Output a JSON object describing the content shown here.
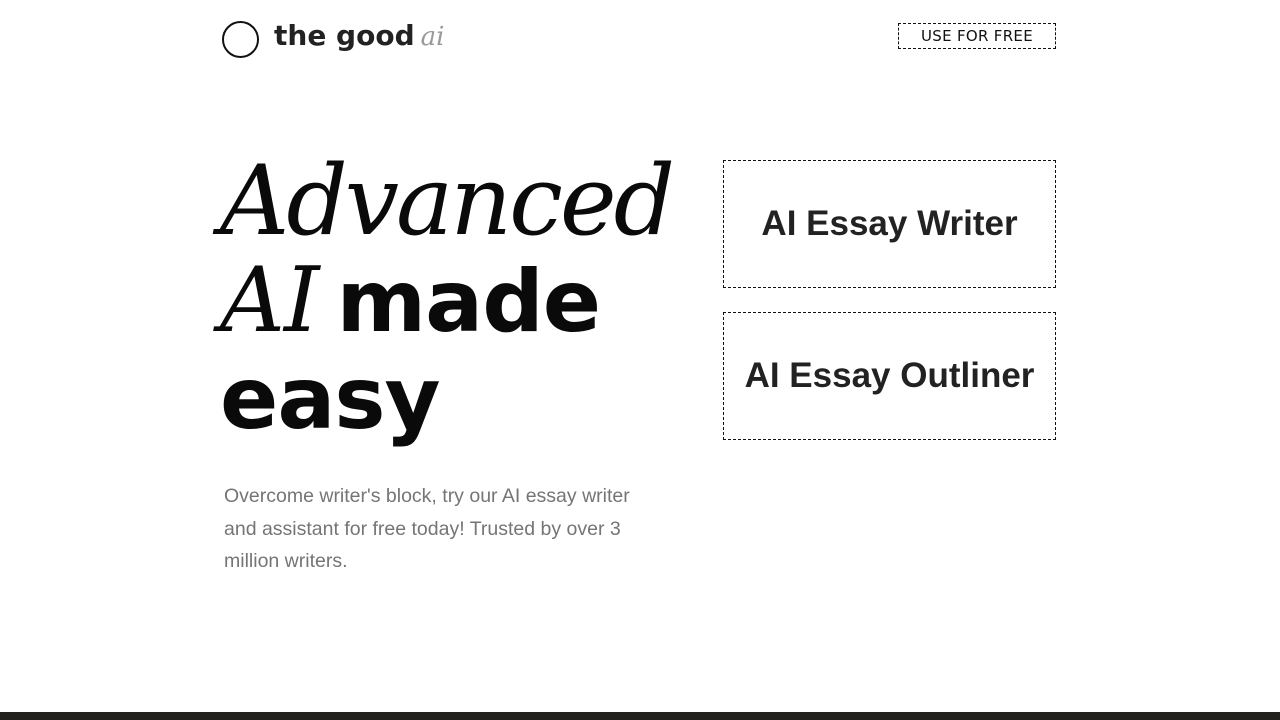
{
  "header": {
    "brand_main": "the good",
    "brand_ai": "ai",
    "cta_label": "USE FOR FREE"
  },
  "hero": {
    "line1": "Advanced",
    "line2_italic": "AI",
    "line2_bold": "made",
    "line3": "easy",
    "subtitle": "Overcome writer's block, try our AI essay writer and assistant for free today! Trusted by over 3 million writers."
  },
  "tools": [
    {
      "label": "AI Essay Writer"
    },
    {
      "label": "AI Essay Outliner"
    }
  ],
  "colors": {
    "text": "#111111",
    "muted": "#757575",
    "brand_ai": "#9a9a9a",
    "footer": "#23221e",
    "background": "#ffffff"
  },
  "icons": {
    "logo": "circle-logo-icon"
  }
}
